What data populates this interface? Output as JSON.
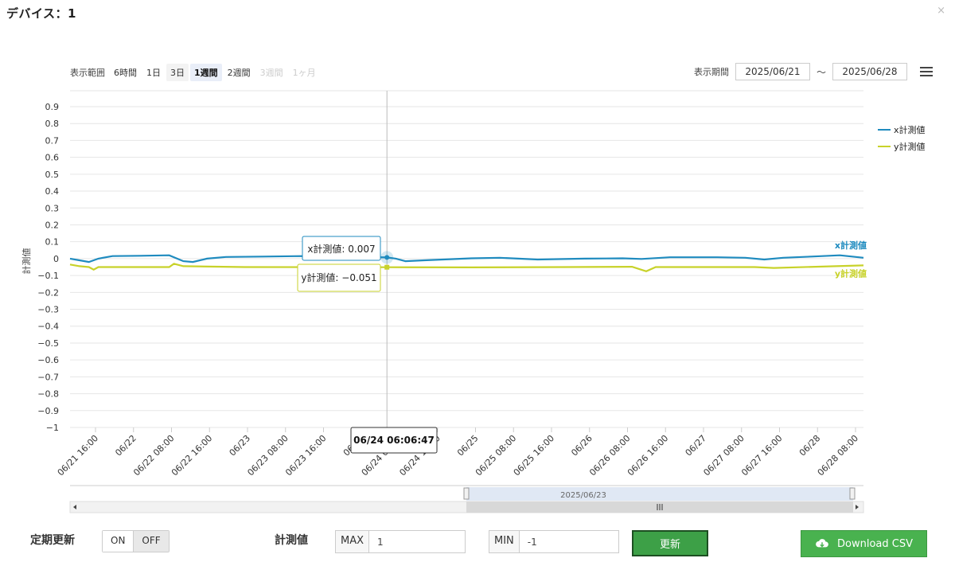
{
  "modal": {
    "title": "デバイス：1",
    "close": "×"
  },
  "range": {
    "label": "表示範囲",
    "options": [
      {
        "label": "6時間",
        "state": "normal"
      },
      {
        "label": "1日",
        "state": "normal"
      },
      {
        "label": "3日",
        "state": "shaded"
      },
      {
        "label": "1週間",
        "state": "active"
      },
      {
        "label": "2週間",
        "state": "normal"
      },
      {
        "label": "3週間",
        "state": "disabled"
      },
      {
        "label": "1ヶ月",
        "state": "disabled"
      }
    ]
  },
  "period": {
    "label": "表示期間",
    "from": "2025/06/21",
    "separator": "～",
    "to": "2025/06/28"
  },
  "chart_data": {
    "type": "line",
    "ylabel": "計測値",
    "ylim": [
      -1,
      0.9
    ],
    "yticks": [
      "0.9",
      "0.8",
      "0.7",
      "0.6",
      "0.5",
      "0.4",
      "0.3",
      "0.2",
      "0.1",
      "0",
      "−0.1",
      "−0.2",
      "−0.3",
      "−0.4",
      "−0.5",
      "−0.6",
      "−0.7",
      "−0.8",
      "−0.9",
      "−1"
    ],
    "xlim": [
      "2025-06-21 11:00",
      "2025-06-28 11:00"
    ],
    "xticks": [
      "06/21 16:00",
      "06/22",
      "06/22 08:00",
      "06/22 16:00",
      "06/23",
      "06/23 08:00",
      "06/23 16:00",
      "06/24",
      "06/24 08:00",
      "06/24 16:00",
      "06/25",
      "06/25 08:00",
      "06/25 16:00",
      "06/26",
      "06/26 08:00",
      "06/26 16:00",
      "06/27",
      "06/27 08:00",
      "06/27 16:00",
      "06/28",
      "06/28 08:00"
    ],
    "series": [
      {
        "name": "x計測値",
        "color": "#1f8bbf",
        "points": [
          [
            "2025-06-21 11:00",
            0.0
          ],
          [
            "2025-06-21 13:00",
            -0.01
          ],
          [
            "2025-06-21 15:00",
            -0.02
          ],
          [
            "2025-06-21 17:00",
            0.0
          ],
          [
            "2025-06-21 20:00",
            0.015
          ],
          [
            "2025-06-22 02:00",
            0.017
          ],
          [
            "2025-06-22 08:00",
            0.02
          ],
          [
            "2025-06-22 11:00",
            -0.015
          ],
          [
            "2025-06-22 13:00",
            -0.02
          ],
          [
            "2025-06-22 16:00",
            0.0
          ],
          [
            "2025-06-22 20:00",
            0.01
          ],
          [
            "2025-06-23 04:00",
            0.012
          ],
          [
            "2025-06-23 12:00",
            0.015
          ],
          [
            "2025-06-23 20:00",
            0.012
          ],
          [
            "2025-06-24 02:00",
            0.01
          ],
          [
            "2025-06-24 06:06",
            0.007
          ],
          [
            "2025-06-24 08:00",
            0.0
          ],
          [
            "2025-06-24 10:00",
            -0.015
          ],
          [
            "2025-06-24 14:00",
            -0.01
          ],
          [
            "2025-06-25 00:00",
            0.002
          ],
          [
            "2025-06-25 06:00",
            0.005
          ],
          [
            "2025-06-25 14:00",
            -0.005
          ],
          [
            "2025-06-26 00:00",
            0.0
          ],
          [
            "2025-06-26 08:00",
            0.002
          ],
          [
            "2025-06-26 12:00",
            -0.002
          ],
          [
            "2025-06-26 18:00",
            0.008
          ],
          [
            "2025-06-27 04:00",
            0.008
          ],
          [
            "2025-06-27 10:00",
            0.005
          ],
          [
            "2025-06-27 14:00",
            -0.005
          ],
          [
            "2025-06-27 18:00",
            0.005
          ],
          [
            "2025-06-28 00:00",
            0.012
          ],
          [
            "2025-06-28 06:00",
            0.02
          ],
          [
            "2025-06-28 11:00",
            0.005
          ]
        ]
      },
      {
        "name": "y計測値",
        "color": "#c8d22a",
        "points": [
          [
            "2025-06-21 11:00",
            -0.035
          ],
          [
            "2025-06-21 13:00",
            -0.045
          ],
          [
            "2025-06-21 15:00",
            -0.05
          ],
          [
            "2025-06-21 16:00",
            -0.065
          ],
          [
            "2025-06-21 17:00",
            -0.05
          ],
          [
            "2025-06-22 08:00",
            -0.05
          ],
          [
            "2025-06-22 09:00",
            -0.03
          ],
          [
            "2025-06-22 11:00",
            -0.045
          ],
          [
            "2025-06-23 00:00",
            -0.05
          ],
          [
            "2025-06-24 06:06",
            -0.051
          ],
          [
            "2025-06-25 00:00",
            -0.052
          ],
          [
            "2025-06-25 20:00",
            -0.05
          ],
          [
            "2025-06-26 10:00",
            -0.048
          ],
          [
            "2025-06-26 13:00",
            -0.075
          ],
          [
            "2025-06-26 15:00",
            -0.05
          ],
          [
            "2025-06-27 12:00",
            -0.05
          ],
          [
            "2025-06-27 16:00",
            -0.055
          ],
          [
            "2025-06-28 11:00",
            -0.04
          ]
        ]
      }
    ],
    "tooltip": {
      "time": "06/24 06:06:47",
      "x_label": "x計測値: 0.007",
      "y_label": "y計測値: −0.051"
    },
    "navigator": {
      "label": "2025/06/23"
    }
  },
  "controls": {
    "auto_update_label": "定期更新",
    "on": "ON",
    "off": "OFF",
    "value_label": "計測値",
    "max_label": "MAX",
    "max_value": "1",
    "min_label": "MIN",
    "min_value": "-1",
    "update_button": "更新",
    "csv_button": "Download CSV"
  }
}
